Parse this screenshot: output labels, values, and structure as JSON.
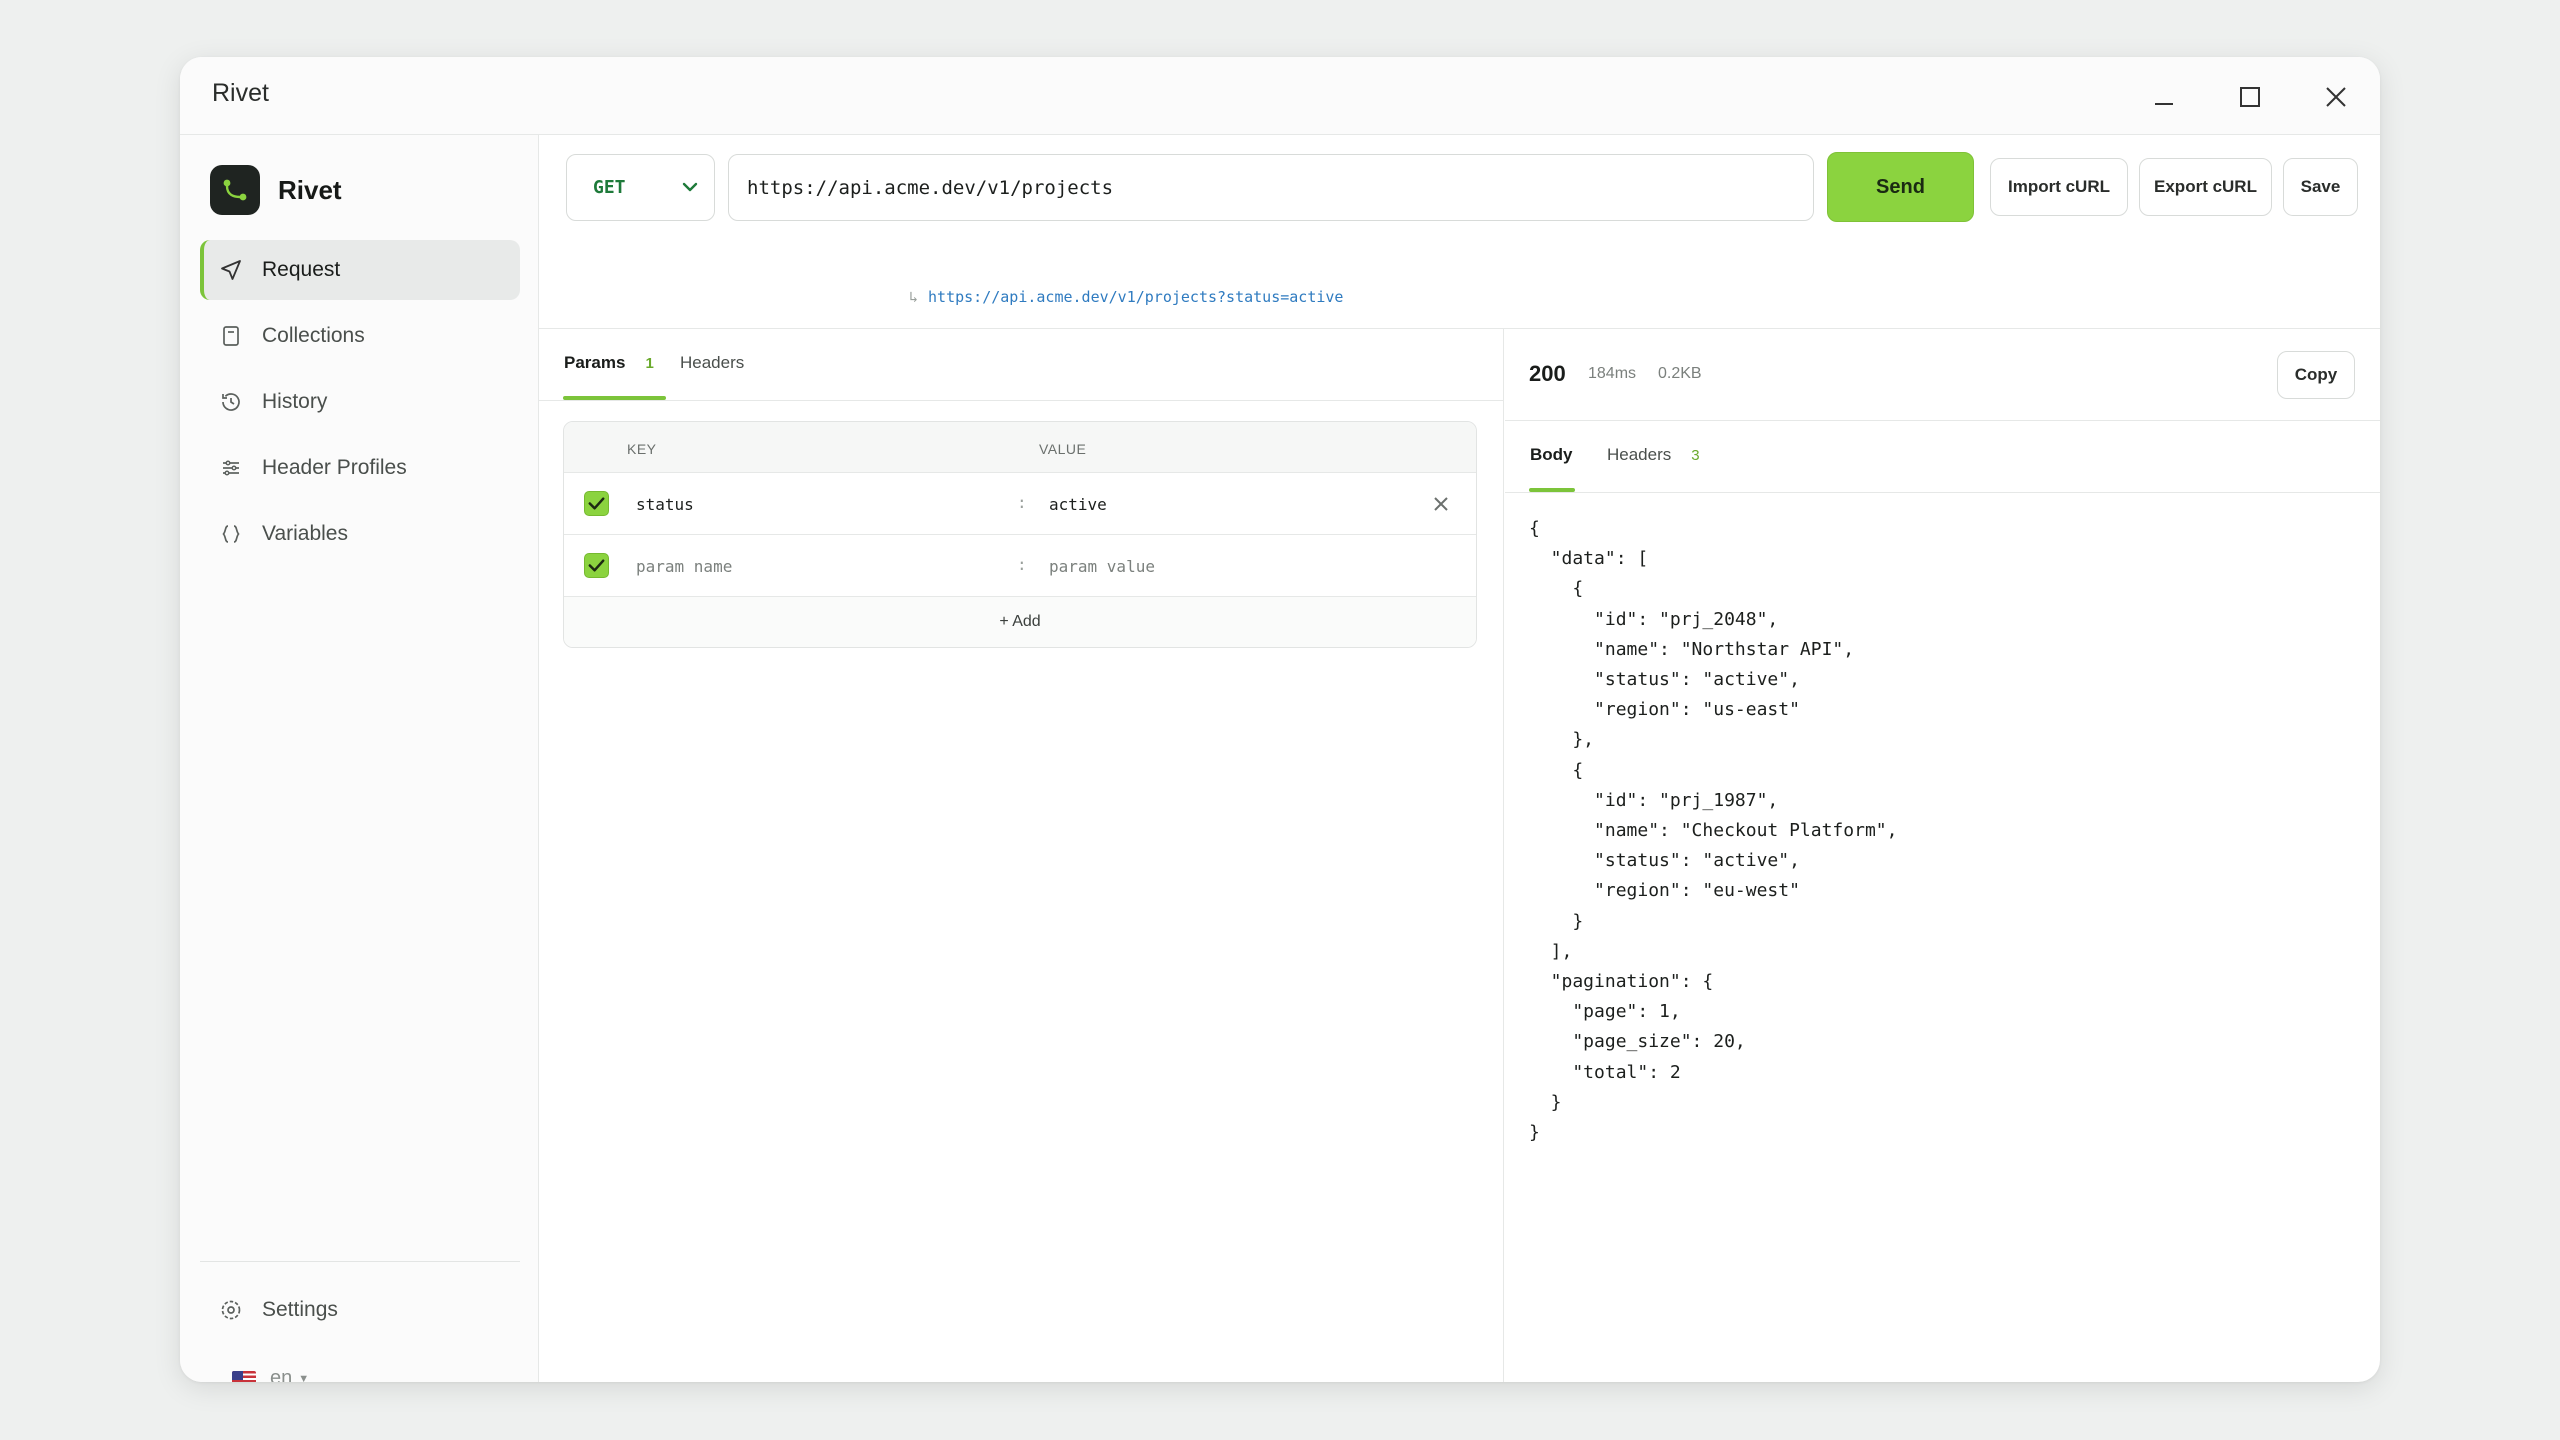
{
  "window": {
    "title": "Rivet"
  },
  "sidebar": {
    "brand": "Rivet",
    "items": [
      {
        "label": "Request",
        "icon": "send-icon"
      },
      {
        "label": "Collections",
        "icon": "book-icon"
      },
      {
        "label": "History",
        "icon": "history-icon"
      },
      {
        "label": "Header Profiles",
        "icon": "sliders-icon"
      },
      {
        "label": "Variables",
        "icon": "braces-icon"
      }
    ],
    "settings": "Settings",
    "language": "en"
  },
  "request": {
    "method": "GET",
    "url": "https://api.acme.dev/v1/projects",
    "resolved_url": "https://api.acme.dev/v1/projects?status=active",
    "send_label": "Send",
    "import_label": "Import cURL",
    "export_label": "Export cURL",
    "save_label": "Save"
  },
  "params_tabs": {
    "params": "Params",
    "params_count": "1",
    "headers": "Headers"
  },
  "params_table": {
    "key_header": "KEY",
    "value_header": "VALUE",
    "rows": [
      {
        "key": "status",
        "value": "active"
      }
    ],
    "new_row": {
      "key_placeholder": "param name",
      "value_placeholder": "param value"
    },
    "add_label": "+ Add"
  },
  "response": {
    "status": "200",
    "time": "184ms",
    "size": "0.2KB",
    "copy_label": "Copy",
    "tabs": {
      "body": "Body",
      "headers": "Headers",
      "headers_count": "3"
    },
    "body": "{\n  \"data\": [\n    {\n      \"id\": \"prj_2048\",\n      \"name\": \"Northstar API\",\n      \"status\": \"active\",\n      \"region\": \"us-east\"\n    },\n    {\n      \"id\": \"prj_1987\",\n      \"name\": \"Checkout Platform\",\n      \"status\": \"active\",\n      \"region\": \"eu-west\"\n    }\n  ],\n  \"pagination\": {\n    \"page\": 1,\n    \"page_size\": 20,\n    \"total\": 2\n  }\n}"
  },
  "colors": {
    "accent": "#8bd33f",
    "method": "#1e7a3a",
    "link": "#2f7bc0"
  }
}
